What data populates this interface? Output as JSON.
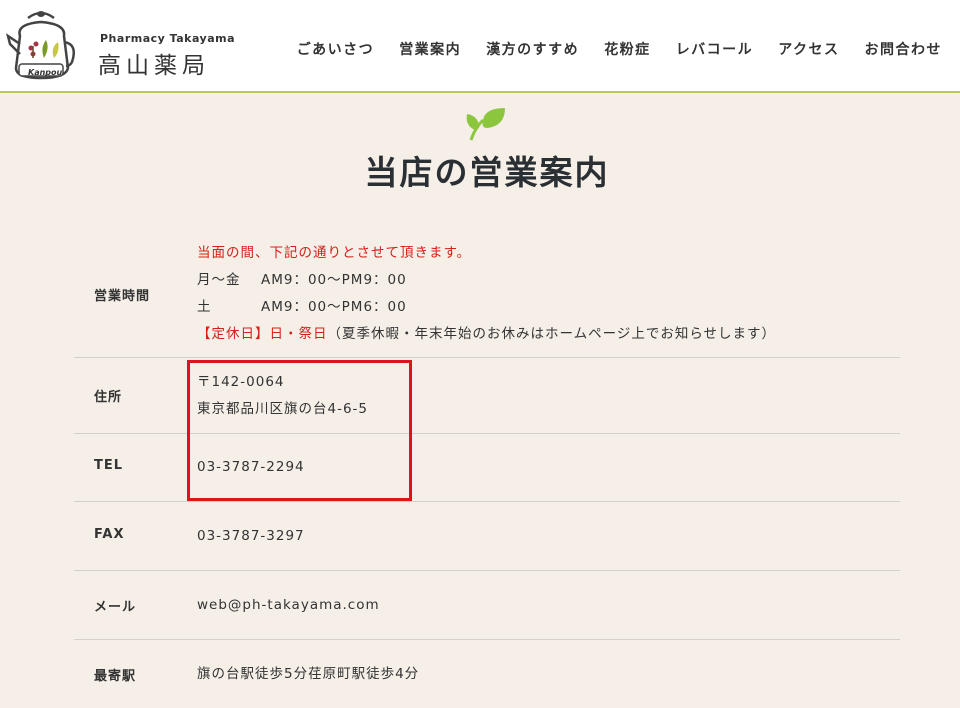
{
  "header": {
    "logo_en": "Pharmacy Takayama",
    "logo_jp": "高山薬局",
    "logo_kanpou": "Kanpou",
    "nav": [
      "ごあいさつ",
      "営業案内",
      "漢方のすすめ",
      "花粉症",
      "レバコール",
      "アクセス",
      "お問合わせ"
    ]
  },
  "page_title": "当店の営業案内",
  "hours": {
    "label": "営業時間",
    "notice": "当面の間、下記の通りとさせて頂きます。",
    "weekday_day": "月～金",
    "weekday_time": "AM9：00～PM9：00",
    "saturday_day": "土",
    "saturday_time": "AM9：00～PM6：00",
    "closed_label": "【定休日】日・祭日",
    "closed_note": "（夏季休暇・年末年始のお休みはホームページ上でお知らせします）"
  },
  "address": {
    "label": "住所",
    "postal": "〒142-0064",
    "street": "東京都品川区旗の台4-6-5"
  },
  "tel": {
    "label": "TEL",
    "value": "03-3787-2294"
  },
  "fax": {
    "label": "FAX",
    "value": "03-3787-3297"
  },
  "mail": {
    "label": "メール",
    "value": "web@ph-takayama.com"
  },
  "station": {
    "label": "最寄駅",
    "value": "旗の台駅徒歩5分荏原町駅徒歩4分"
  },
  "colors": {
    "accent": "#b9c95a",
    "leaf": "#8cc63f",
    "notice": "#d6201a",
    "highlight": "#e0121a"
  }
}
